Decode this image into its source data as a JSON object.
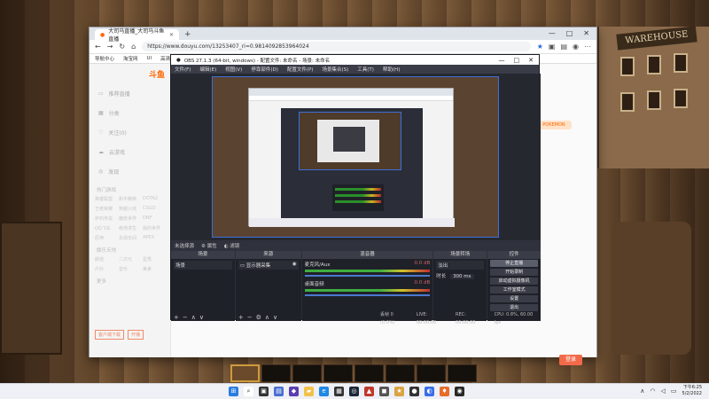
{
  "background": {
    "sign_text": "WAREHOUSE"
  },
  "browser": {
    "tab_title": "大司马直播_大司马斗鱼直播",
    "tab_close": "✕",
    "new_tab": "+",
    "window_controls": [
      "—",
      "□",
      "✕"
    ],
    "url": "https://www.douyu.com/13253407_ri=0.9814092853964024",
    "bookmarks": [
      "导航中心",
      "淘宝网",
      "Ul",
      "高清视频"
    ],
    "nav": {
      "back": "←",
      "forward": "→",
      "refresh": "↻",
      "home": "⌂"
    }
  },
  "site": {
    "logo": "斗鱼",
    "sidebar_items": [
      "推荐直播",
      "分类",
      "关注(0)",
      "云游戏",
      "发现"
    ],
    "section_hot": "热门游戏",
    "hot_games": [
      "英雄联盟",
      "和平精英",
      "DOTA2",
      "王者荣耀",
      "穿越火线",
      "CSGO",
      "炉石传说",
      "魔兽世界",
      "DNF",
      "QQ飞车",
      "绝地求生",
      "我的世界",
      "原神",
      "永劫无间",
      "APEX"
    ],
    "section_variety": "娱乐天地",
    "variety": [
      "颜值",
      "二次元",
      "星秀",
      "户外",
      "音乐",
      "美食",
      "舞蹈",
      "脱口秀",
      "综艺"
    ],
    "section_more": "更多",
    "buttons": [
      "客户端下载",
      "开播"
    ],
    "right_badge": "POKEMON",
    "cta": "登录"
  },
  "obs": {
    "title": "OBS 27.1.3 (64-bit, windows) - 配置文件: 未命名 - 场景: 未命名",
    "menu": [
      "文件(F)",
      "编辑(E)",
      "视图(V)",
      "停靠部件(D)",
      "配置文件(P)",
      "场景集合(S)",
      "工具(T)",
      "帮助(H)"
    ],
    "scene_bar": {
      "label": "未选择源",
      "properties": "属性",
      "filters": "滤镜"
    },
    "docks": {
      "scenes": {
        "title": "场景",
        "items": [
          "场景"
        ]
      },
      "sources": {
        "title": "来源",
        "items": [
          "显示器采集"
        ]
      },
      "mixer": {
        "title": "混音器",
        "channels": [
          {
            "name": "桌面音频",
            "db": "0.0 dB"
          },
          {
            "name": "麦克风/Aux",
            "db": "0.0 dB"
          }
        ]
      },
      "transitions": {
        "title": "场景转场",
        "type": "淡出",
        "duration_label": "时长",
        "duration": "300 ms"
      },
      "controls": {
        "title": "控件",
        "buttons": [
          "停止直播",
          "开始录制",
          "启动虚拟摄像机",
          "工作室模式",
          "设置",
          "退出"
        ]
      }
    },
    "status": {
      "drop": "丢帧 0 (0.0%)",
      "live": "LIVE: 00:00:00",
      "rec": "REC: 00:00:00",
      "cpu": "CPU: 0.8%, 60.00 fps"
    }
  },
  "taskbar": {
    "time": "下午6:25",
    "date": "5/2/2022"
  }
}
